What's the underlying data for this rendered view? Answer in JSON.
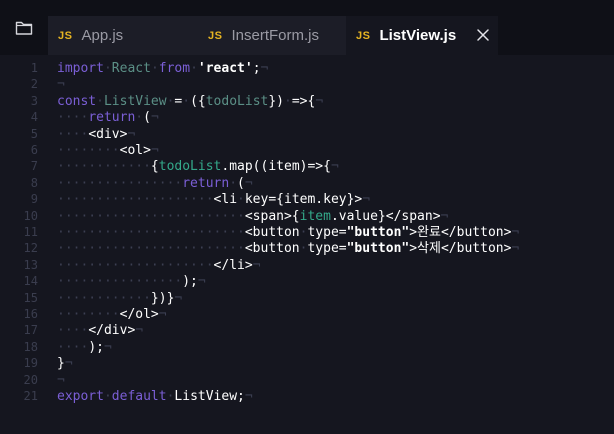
{
  "tabs": [
    {
      "badge": "JS",
      "title": "App.js"
    },
    {
      "badge": "JS",
      "title": "InsertForm.js"
    },
    {
      "badge": "JS",
      "title": "ListView.js"
    }
  ],
  "colors": {
    "keyword": "#7b5fd6",
    "identifier": "#5b8f86",
    "string": "#ffffff",
    "whitespace_marker": "#3c3f52",
    "js_badge": "#e6b422",
    "editor_background": "#15161f"
  },
  "icons": {
    "explorer": "folder-icon",
    "close": "close-icon"
  },
  "lines": [
    {
      "num": "1",
      "segs": [
        {
          "c": "k",
          "t": "import"
        },
        {
          "c": "d",
          "t": "·"
        },
        {
          "c": "n",
          "t": "React"
        },
        {
          "c": "d",
          "t": "·"
        },
        {
          "c": "k",
          "t": "from"
        },
        {
          "c": "d",
          "t": "·"
        },
        {
          "c": "s",
          "t": "'react'"
        },
        {
          "c": "p",
          "t": ";"
        },
        {
          "c": "d",
          "t": "¬"
        }
      ]
    },
    {
      "num": "2",
      "segs": [
        {
          "c": "d",
          "t": "¬"
        }
      ]
    },
    {
      "num": "3",
      "segs": [
        {
          "c": "k",
          "t": "const"
        },
        {
          "c": "d",
          "t": "·"
        },
        {
          "c": "n",
          "t": "ListView"
        },
        {
          "c": "d",
          "t": "·"
        },
        {
          "c": "p",
          "t": "="
        },
        {
          "c": "d",
          "t": "·"
        },
        {
          "c": "p",
          "t": "({"
        },
        {
          "c": "n",
          "t": "todoList"
        },
        {
          "c": "p",
          "t": "})"
        },
        {
          "c": "d",
          "t": "·"
        },
        {
          "c": "p",
          "t": "=>{"
        },
        {
          "c": "d",
          "t": "¬"
        }
      ]
    },
    {
      "num": "4",
      "segs": [
        {
          "c": "d",
          "t": "····"
        },
        {
          "c": "k",
          "t": "return"
        },
        {
          "c": "d",
          "t": "·"
        },
        {
          "c": "p",
          "t": "("
        },
        {
          "c": "d",
          "t": "¬"
        }
      ]
    },
    {
      "num": "5",
      "segs": [
        {
          "c": "d",
          "t": "····"
        },
        {
          "c": "p",
          "t": "<div>"
        },
        {
          "c": "d",
          "t": "¬"
        }
      ]
    },
    {
      "num": "6",
      "segs": [
        {
          "c": "d",
          "t": "········"
        },
        {
          "c": "p",
          "t": "<ol>"
        },
        {
          "c": "d",
          "t": "¬"
        }
      ]
    },
    {
      "num": "7",
      "segs": [
        {
          "c": "d",
          "t": "············"
        },
        {
          "c": "p",
          "t": "{"
        },
        {
          "c": "g",
          "t": "todoList"
        },
        {
          "c": "p",
          "t": ".map((item)=>{"
        },
        {
          "c": "d",
          "t": "¬"
        }
      ]
    },
    {
      "num": "8",
      "segs": [
        {
          "c": "d",
          "t": "················"
        },
        {
          "c": "k",
          "t": "return"
        },
        {
          "c": "d",
          "t": "·"
        },
        {
          "c": "p",
          "t": "("
        },
        {
          "c": "d",
          "t": "¬"
        }
      ]
    },
    {
      "num": "9",
      "segs": [
        {
          "c": "d",
          "t": "····················"
        },
        {
          "c": "p",
          "t": "<li"
        },
        {
          "c": "d",
          "t": "·"
        },
        {
          "c": "p",
          "t": "key={item.key}>"
        },
        {
          "c": "d",
          "t": "¬"
        }
      ]
    },
    {
      "num": "10",
      "segs": [
        {
          "c": "d",
          "t": "························"
        },
        {
          "c": "p",
          "t": "<span>{"
        },
        {
          "c": "g",
          "t": "item"
        },
        {
          "c": "p",
          "t": ".value}</span>"
        },
        {
          "c": "d",
          "t": "¬"
        }
      ]
    },
    {
      "num": "11",
      "segs": [
        {
          "c": "d",
          "t": "························"
        },
        {
          "c": "p",
          "t": "<button"
        },
        {
          "c": "d",
          "t": "·"
        },
        {
          "c": "p",
          "t": "type="
        },
        {
          "c": "s",
          "t": "\"button\""
        },
        {
          "c": "p",
          "t": ">완료</button>"
        },
        {
          "c": "d",
          "t": "¬"
        }
      ]
    },
    {
      "num": "12",
      "segs": [
        {
          "c": "d",
          "t": "························"
        },
        {
          "c": "p",
          "t": "<button"
        },
        {
          "c": "d",
          "t": "·"
        },
        {
          "c": "p",
          "t": "type="
        },
        {
          "c": "s",
          "t": "\"button\""
        },
        {
          "c": "p",
          "t": ">삭제</button>"
        },
        {
          "c": "d",
          "t": "¬"
        }
      ]
    },
    {
      "num": "13",
      "segs": [
        {
          "c": "d",
          "t": "····················"
        },
        {
          "c": "p",
          "t": "</li>"
        },
        {
          "c": "d",
          "t": "¬"
        }
      ]
    },
    {
      "num": "14",
      "segs": [
        {
          "c": "d",
          "t": "················"
        },
        {
          "c": "p",
          "t": ");"
        },
        {
          "c": "d",
          "t": "¬"
        }
      ]
    },
    {
      "num": "15",
      "segs": [
        {
          "c": "d",
          "t": "············"
        },
        {
          "c": "p",
          "t": "})}"
        },
        {
          "c": "d",
          "t": "¬"
        }
      ]
    },
    {
      "num": "16",
      "segs": [
        {
          "c": "d",
          "t": "········"
        },
        {
          "c": "p",
          "t": "</ol>"
        },
        {
          "c": "d",
          "t": "¬"
        }
      ]
    },
    {
      "num": "17",
      "segs": [
        {
          "c": "d",
          "t": "····"
        },
        {
          "c": "p",
          "t": "</div>"
        },
        {
          "c": "d",
          "t": "¬"
        }
      ]
    },
    {
      "num": "18",
      "segs": [
        {
          "c": "d",
          "t": "····"
        },
        {
          "c": "p",
          "t": ");"
        },
        {
          "c": "d",
          "t": "¬"
        }
      ]
    },
    {
      "num": "19",
      "segs": [
        {
          "c": "p",
          "t": "}"
        },
        {
          "c": "d",
          "t": "¬"
        }
      ]
    },
    {
      "num": "20",
      "segs": [
        {
          "c": "d",
          "t": "¬"
        }
      ]
    },
    {
      "num": "21",
      "segs": [
        {
          "c": "k",
          "t": "export"
        },
        {
          "c": "d",
          "t": "·"
        },
        {
          "c": "k",
          "t": "default"
        },
        {
          "c": "d",
          "t": "·"
        },
        {
          "c": "p",
          "t": "ListView;"
        },
        {
          "c": "d",
          "t": "¬"
        }
      ]
    }
  ]
}
